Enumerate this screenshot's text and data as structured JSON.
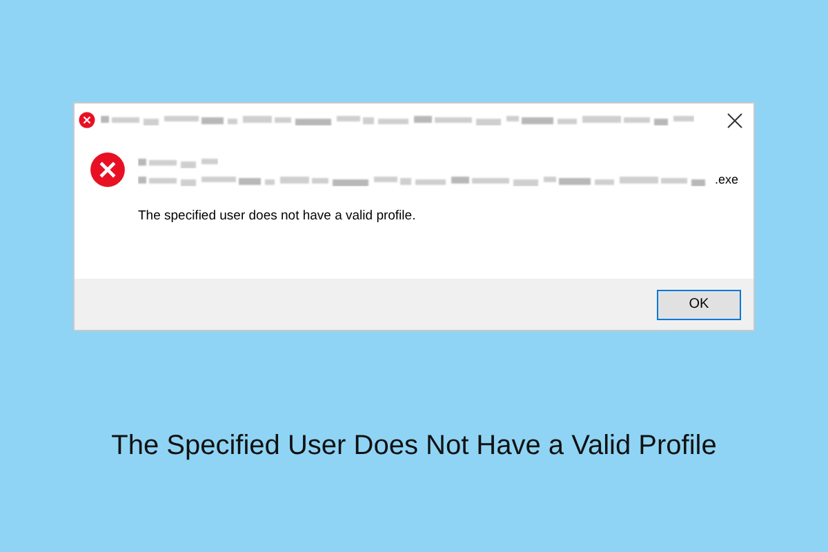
{
  "dialog": {
    "path_suffix": ".exe",
    "message": "The specified user does not have a valid profile.",
    "buttons": [
      {
        "label": "OK",
        "selected": true
      }
    ]
  },
  "caption": "The Specified User Does Not Have a Valid Profile"
}
